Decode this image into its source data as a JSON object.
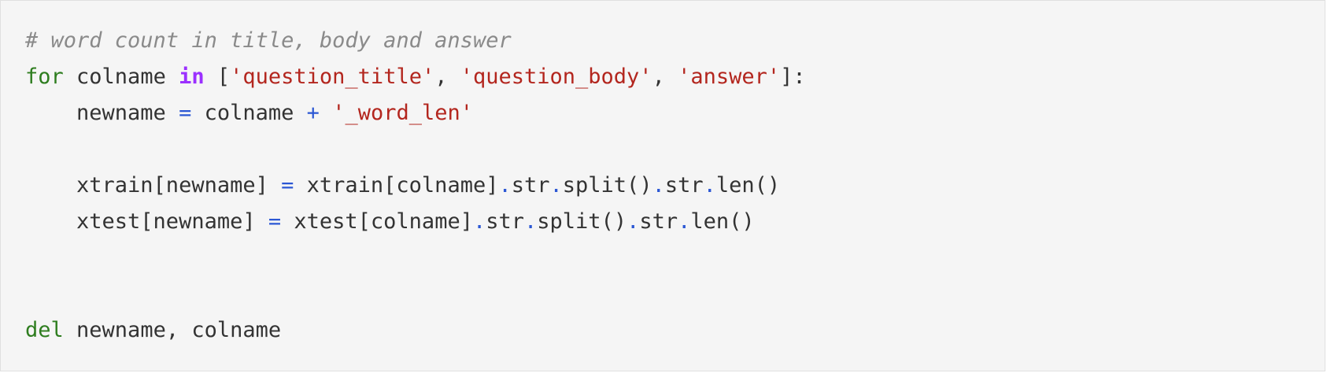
{
  "cell": {
    "lines": [
      {
        "id": "line-1",
        "tokens": [
          {
            "type": "comment",
            "text": "# word count in title, body and answer"
          }
        ]
      },
      {
        "id": "line-2",
        "tokens": [
          {
            "type": "kw",
            "text": "for"
          },
          {
            "type": "plain",
            "text": " colname "
          },
          {
            "type": "kw-in",
            "text": "in"
          },
          {
            "type": "plain",
            "text": " ["
          },
          {
            "type": "str",
            "text": "'question_title'"
          },
          {
            "type": "plain",
            "text": ", "
          },
          {
            "type": "str",
            "text": "'question_body'"
          },
          {
            "type": "plain",
            "text": ", "
          },
          {
            "type": "str",
            "text": "'answer'"
          },
          {
            "type": "plain",
            "text": "]:"
          }
        ]
      },
      {
        "id": "line-3",
        "tokens": [
          {
            "type": "plain",
            "text": "    newname "
          },
          {
            "type": "op",
            "text": "="
          },
          {
            "type": "plain",
            "text": " colname "
          },
          {
            "type": "op",
            "text": "+"
          },
          {
            "type": "plain",
            "text": " "
          },
          {
            "type": "str",
            "text": "'_word_len'"
          }
        ]
      },
      {
        "id": "line-4",
        "tokens": []
      },
      {
        "id": "line-5",
        "tokens": [
          {
            "type": "plain",
            "text": "    xtrain[newname] "
          },
          {
            "type": "op",
            "text": "="
          },
          {
            "type": "plain",
            "text": " xtrain[colname]"
          },
          {
            "type": "dot",
            "text": "."
          },
          {
            "type": "plain",
            "text": "str"
          },
          {
            "type": "dot",
            "text": "."
          },
          {
            "type": "plain",
            "text": "split()"
          },
          {
            "type": "dot",
            "text": "."
          },
          {
            "type": "plain",
            "text": "str"
          },
          {
            "type": "dot",
            "text": "."
          },
          {
            "type": "plain",
            "text": "len()"
          }
        ]
      },
      {
        "id": "line-6",
        "tokens": [
          {
            "type": "plain",
            "text": "    xtest[newname] "
          },
          {
            "type": "op",
            "text": "="
          },
          {
            "type": "plain",
            "text": " xtest[colname]"
          },
          {
            "type": "dot",
            "text": "."
          },
          {
            "type": "plain",
            "text": "str"
          },
          {
            "type": "dot",
            "text": "."
          },
          {
            "type": "plain",
            "text": "split()"
          },
          {
            "type": "dot",
            "text": "."
          },
          {
            "type": "plain",
            "text": "str"
          },
          {
            "type": "dot",
            "text": "."
          },
          {
            "type": "plain",
            "text": "len()"
          }
        ]
      },
      {
        "id": "line-7",
        "tokens": []
      },
      {
        "id": "line-8",
        "tokens": []
      },
      {
        "id": "line-9",
        "tokens": [
          {
            "type": "kw",
            "text": "del"
          },
          {
            "type": "plain",
            "text": " newname, colname"
          }
        ]
      }
    ]
  },
  "colors": {
    "background": "#f5f5f5",
    "text": "#333333",
    "comment": "#8a8a8a",
    "keyword": "#2e7d1f",
    "keyword_in": "#9b30ff",
    "string": "#b3261e",
    "operator": "#2b57d4"
  }
}
